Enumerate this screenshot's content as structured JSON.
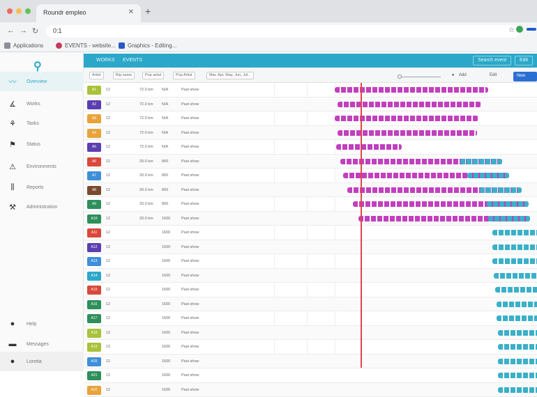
{
  "browser": {
    "tab_title": "Roundr empleo",
    "url": "0:1",
    "bookmarks": [
      "Applications",
      "EVENTS - website...",
      "Graphics - Editing..."
    ]
  },
  "sidebar": {
    "logo_glyph": "⚲",
    "items": [
      {
        "label": "Overview",
        "icon": "chart-line-icon",
        "glyph": "〰",
        "active": true
      },
      {
        "label": "Works",
        "icon": "pipeline-icon",
        "glyph": "∡"
      },
      {
        "label": "Tasks",
        "icon": "tools-icon",
        "glyph": "⚘"
      },
      {
        "label": "Status",
        "icon": "flag-icon",
        "glyph": "⚑"
      },
      {
        "label": "Environments",
        "icon": "sitemap-icon",
        "glyph": "⚠"
      },
      {
        "label": "Reports",
        "icon": "bar-chart-icon",
        "glyph": "⫼"
      },
      {
        "label": "Administration",
        "icon": "wrench-icon",
        "glyph": "⚒"
      }
    ],
    "help_label": "Help",
    "messages_label": "Messages",
    "user_label": "Loretta"
  },
  "topbar": {
    "tab1": "WORKS",
    "tab2": "EVENTS",
    "btn1": "Search event",
    "btn2": "Edit"
  },
  "filters": {
    "chips": [
      "Artist",
      "Big name",
      "Pop artist",
      "Pop Artist",
      "Mar, Apr, May, Jun, Jul..."
    ],
    "btn_add": "Add",
    "btn_edit": "Edit",
    "btn_new": "New"
  },
  "rows": [
    {
      "color": "#a8c23a",
      "name": "A1",
      "c1": "12",
      "c2": "72.0 km",
      "c3": "N/A",
      "c4": "Past show"
    },
    {
      "color": "#5b3fb0",
      "name": "A2",
      "c1": "12",
      "c2": "72.0 km",
      "c3": "N/A",
      "c4": "Past show"
    },
    {
      "color": "#e8a33a",
      "name": "A3",
      "c1": "12",
      "c2": "72.0 km",
      "c3": "N/A",
      "c4": "Past show"
    },
    {
      "color": "#e8a33a",
      "name": "A4",
      "c1": "12",
      "c2": "72.0 km",
      "c3": "N/A",
      "c4": "Past show"
    },
    {
      "color": "#5b3fb0",
      "name": "A5",
      "c1": "12",
      "c2": "72.0 km",
      "c3": "N/A",
      "c4": "Past show"
    },
    {
      "color": "#d9483b",
      "name": "A6",
      "c1": "12",
      "c2": "20.0 km",
      "c3": "800",
      "c4": "Past show"
    },
    {
      "color": "#3e8fd9",
      "name": "A7",
      "c1": "12",
      "c2": "20.0 km",
      "c3": "800",
      "c4": "Past show"
    },
    {
      "color": "#7a4a2e",
      "name": "A8",
      "c1": "12",
      "c2": "20.0 km",
      "c3": "800",
      "c4": "Past show"
    },
    {
      "color": "#2e8f5a",
      "name": "A9",
      "c1": "12",
      "c2": "20.0 km",
      "c3": "800",
      "c4": "Past show"
    },
    {
      "color": "#2e8f5a",
      "name": "A10",
      "c1": "12",
      "c2": "20.0 km",
      "c3": "1600",
      "c4": "Past show"
    },
    {
      "color": "#d9483b",
      "name": "A11",
      "c1": "12",
      "c2": "",
      "c3": "1600",
      "c4": "Past show"
    },
    {
      "color": "#5b3fb0",
      "name": "A12",
      "c1": "12",
      "c2": "",
      "c3": "1600",
      "c4": "Past show"
    },
    {
      "color": "#3e8fd9",
      "name": "A13",
      "c1": "12",
      "c2": "",
      "c3": "1600",
      "c4": "Past show"
    },
    {
      "color": "#2ba8c9",
      "name": "A14",
      "c1": "12",
      "c2": "",
      "c3": "1600",
      "c4": "Past show"
    },
    {
      "color": "#d9483b",
      "name": "A15",
      "c1": "12",
      "c2": "",
      "c3": "1600",
      "c4": "Past show"
    },
    {
      "color": "#2e8f5a",
      "name": "A16",
      "c1": "12",
      "c2": "",
      "c3": "1600",
      "c4": "Past show"
    },
    {
      "color": "#2e8f5a",
      "name": "A17",
      "c1": "12",
      "c2": "",
      "c3": "1600",
      "c4": "Past show"
    },
    {
      "color": "#a8c23a",
      "name": "A18",
      "c1": "12",
      "c2": "",
      "c3": "1600",
      "c4": "Past show"
    },
    {
      "color": "#a8c23a",
      "name": "A19",
      "c1": "12",
      "c2": "",
      "c3": "1600",
      "c4": "Past show"
    },
    {
      "color": "#3e8fd9",
      "name": "A20",
      "c1": "12",
      "c2": "",
      "c3": "1600",
      "c4": "Past show"
    },
    {
      "color": "#2e8f5a",
      "name": "A21",
      "c1": "12",
      "c2": "",
      "c3": "1600",
      "c4": "Past show"
    },
    {
      "color": "#e8a33a",
      "name": "A22",
      "c1": "12",
      "c2": "",
      "c3": "1600",
      "c4": "Past show"
    }
  ],
  "colors": {
    "accent": "#2ba8c9",
    "magenta": "#c23fbf",
    "teal": "#3ab0c9",
    "now_line": "#e0454c"
  }
}
